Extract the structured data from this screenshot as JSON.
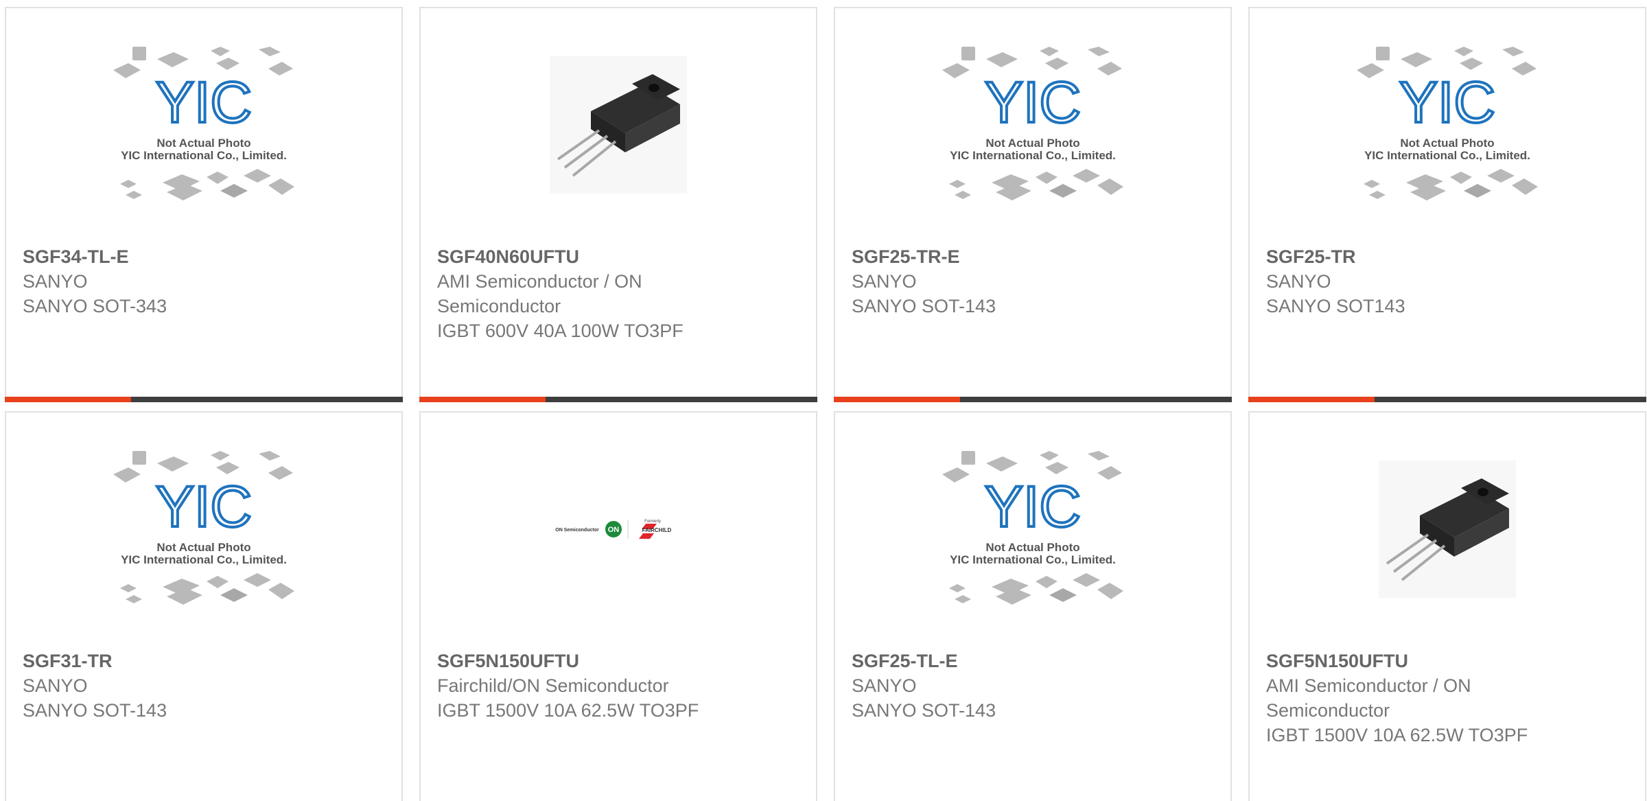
{
  "products": [
    {
      "part": "SGF34-TL-E",
      "manufacturer": "SANYO",
      "description": "SANYO SOT-343",
      "image": "not-actual-photo",
      "image_text": [
        "Not Actual Photo",
        "YIC International Co., Limited."
      ],
      "logo_text": "YIC"
    },
    {
      "part": "SGF40N60UFTU",
      "manufacturer": "AMI Semiconductor / ON",
      "manufacturer_cont": "Semiconductor",
      "description": "IGBT 600V 40A 100W TO3PF",
      "image": "to3pf-package"
    },
    {
      "part": "SGF25-TR-E",
      "manufacturer": "SANYO",
      "description": "SANYO SOT-143",
      "image": "not-actual-photo",
      "image_text": [
        "Not Actual Photo",
        "YIC International Co., Limited."
      ],
      "logo_text": "YIC"
    },
    {
      "part": "SGF25-TR",
      "manufacturer": "SANYO",
      "description": "SANYO SOT143",
      "image": "not-actual-photo",
      "image_text": [
        "Not Actual Photo",
        "YIC International Co., Limited."
      ],
      "logo_text": "YIC"
    },
    {
      "part": "SGF31-TR",
      "manufacturer": "SANYO",
      "description": "SANYO SOT-143",
      "image": "not-actual-photo",
      "image_text": [
        "Not Actual Photo",
        "YIC International Co., Limited."
      ],
      "logo_text": "YIC"
    },
    {
      "part": "SGF5N150UFTU",
      "manufacturer": "Fairchild/ON Semiconductor",
      "description": "IGBT 1500V 10A 62.5W TO3PF",
      "image": "on-fairchild-logo",
      "logo_texts": [
        "ON Semiconductor",
        "ON",
        "Formerly",
        "FAIRCHILD"
      ]
    },
    {
      "part": "SGF25-TL-E",
      "manufacturer": "SANYO",
      "description": "SANYO SOT-143",
      "image": "not-actual-photo",
      "image_text": [
        "Not Actual Photo",
        "YIC International Co., Limited."
      ],
      "logo_text": "YIC"
    },
    {
      "part": "SGF5N150UFTU",
      "manufacturer": "AMI Semiconductor / ON",
      "manufacturer_cont": "Semiconductor",
      "description": "IGBT 1500V 10A 62.5W TO3PF",
      "image": "to3pf-package"
    }
  ],
  "colors": {
    "accent": "#e8411c",
    "bar": "#3e3e3e",
    "border": "#e1e1e1",
    "yic_blue": "#1e73be"
  }
}
